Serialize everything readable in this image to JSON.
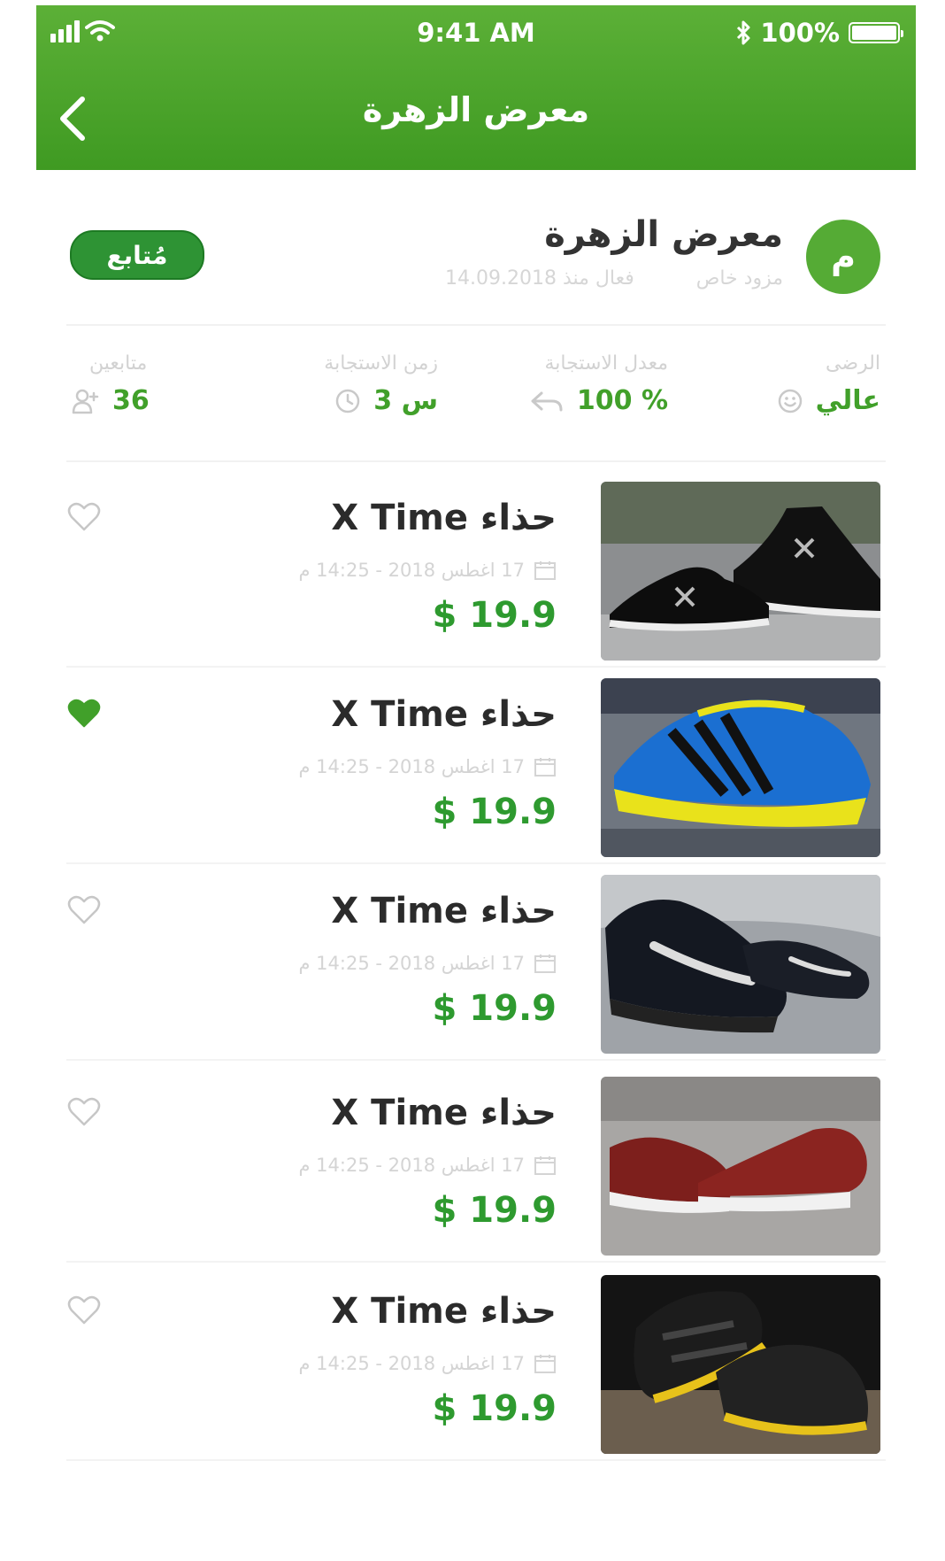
{
  "status_bar": {
    "time": "9:41 AM",
    "battery": "100%"
  },
  "nav": {
    "title": "معرض الزهرة",
    "back_icon": "chevron-left-icon"
  },
  "shop": {
    "avatar_letter": "م",
    "name": "معرض الزهرة",
    "type": "مزود خاص",
    "joined": "فعال منذ 14.09.2018",
    "follow_label": "مُتابع",
    "accent": "#41a02a"
  },
  "stats": [
    {
      "label": "الرضى",
      "value": "عالي",
      "icon": "smile-icon"
    },
    {
      "label": "معدل الاستجابة",
      "value": "100 %",
      "icon": "reply-icon"
    },
    {
      "label": "زمن الاستجابة",
      "value": "3 س",
      "icon": "clock-icon"
    },
    {
      "label": "متابعين",
      "value": "36",
      "icon": "user-add-icon"
    }
  ],
  "products": [
    {
      "title": "حذاء X Time",
      "date": "17 اغطس 2018 - 14:25 م",
      "price": "$ 19.9",
      "favorite": false
    },
    {
      "title": "حذاء X Time",
      "date": "17 اغطس 2018 - 14:25 م",
      "price": "$ 19.9",
      "favorite": true
    },
    {
      "title": "حذاء X Time",
      "date": "17 اغطس 2018 - 14:25 م",
      "price": "$ 19.9",
      "favorite": false
    },
    {
      "title": "حذاء X Time",
      "date": "17 اغطس 2018 - 14:25 م",
      "price": "$ 19.9",
      "favorite": false
    },
    {
      "title": "حذاء X Time",
      "date": "17 اغطس 2018 - 14:25 م",
      "price": "$ 19.9",
      "favorite": false
    }
  ]
}
